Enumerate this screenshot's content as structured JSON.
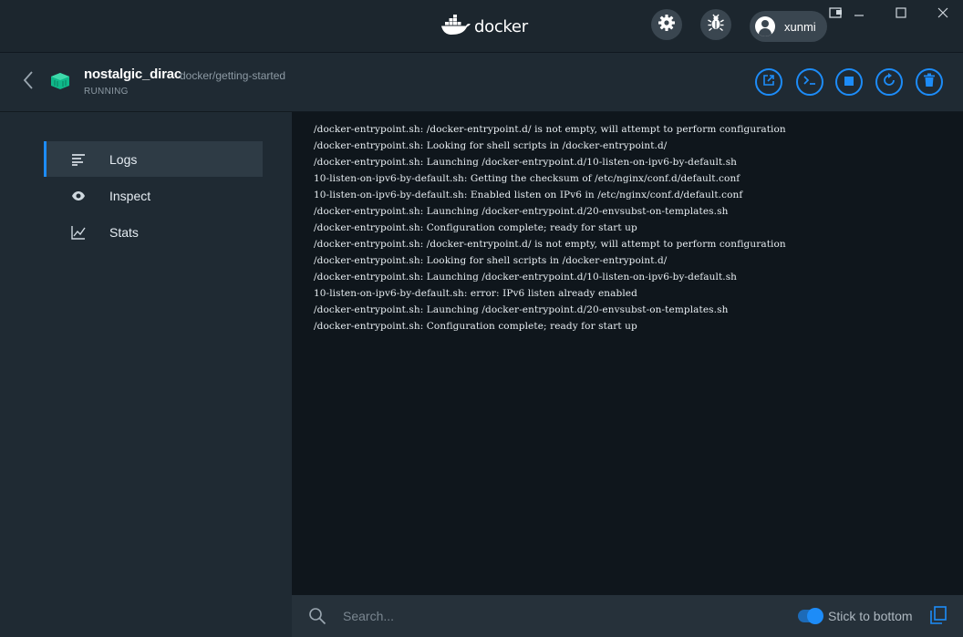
{
  "app": {
    "logo_text": "docker",
    "user": "xunmi",
    "accent_color": "#1d8cf8"
  },
  "container": {
    "name": "nostalgic_dirac",
    "image": "docker/getting-started",
    "status": "RUNNING",
    "status_icon_color": "#0fb98a"
  },
  "sidebar": {
    "items": [
      {
        "label": "Logs",
        "icon": "lines-icon",
        "active": true
      },
      {
        "label": "Inspect",
        "icon": "eye-icon",
        "active": false
      },
      {
        "label": "Stats",
        "icon": "chart-icon",
        "active": false
      }
    ]
  },
  "logs": [
    "/docker-entrypoint.sh: /docker-entrypoint.d/ is not empty, will attempt to perform configuration",
    "/docker-entrypoint.sh: Looking for shell scripts in /docker-entrypoint.d/",
    "/docker-entrypoint.sh: Launching /docker-entrypoint.d/10-listen-on-ipv6-by-default.sh",
    "10-listen-on-ipv6-by-default.sh: Getting the checksum of /etc/nginx/conf.d/default.conf",
    "10-listen-on-ipv6-by-default.sh: Enabled listen on IPv6 in /etc/nginx/conf.d/default.conf",
    "/docker-entrypoint.sh: Launching /docker-entrypoint.d/20-envsubst-on-templates.sh",
    "/docker-entrypoint.sh: Configuration complete; ready for start up",
    "/docker-entrypoint.sh: /docker-entrypoint.d/ is not empty, will attempt to perform configuration",
    "/docker-entrypoint.sh: Looking for shell scripts in /docker-entrypoint.d/",
    "/docker-entrypoint.sh: Launching /docker-entrypoint.d/10-listen-on-ipv6-by-default.sh",
    "10-listen-on-ipv6-by-default.sh: error: IPv6 listen already enabled",
    "/docker-entrypoint.sh: Launching /docker-entrypoint.d/20-envsubst-on-templates.sh",
    "/docker-entrypoint.sh: Configuration complete; ready for start up"
  ],
  "bottom_bar": {
    "search_placeholder": "Search...",
    "stick_to_bottom_label": "Stick to bottom",
    "stick_to_bottom_enabled": true
  }
}
